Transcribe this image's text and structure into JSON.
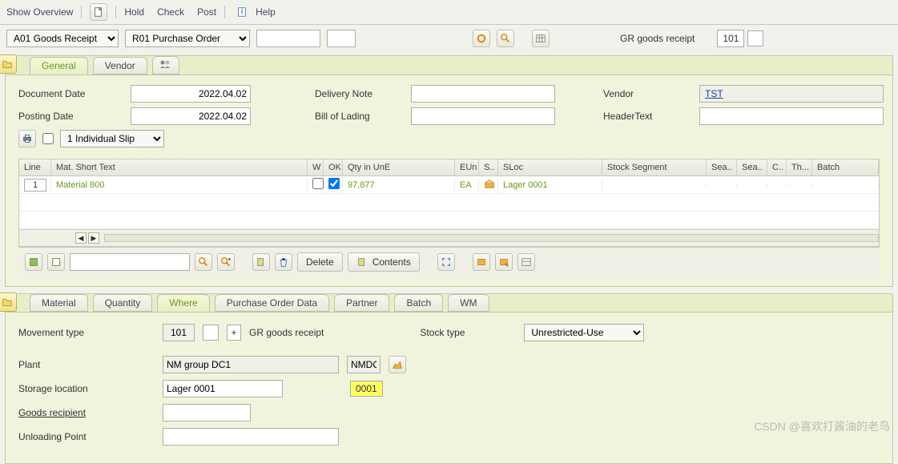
{
  "toolbar": {
    "show_overview": "Show Overview",
    "hold": "Hold",
    "check": "Check",
    "post": "Post",
    "help": "Help"
  },
  "row2": {
    "action": "A01 Goods Receipt",
    "ref": "R01 Purchase Order",
    "gr_label": "GR goods receipt",
    "gr_code": "101"
  },
  "header_tabs": {
    "general": "General",
    "vendor": "Vendor"
  },
  "header": {
    "doc_date_lbl": "Document Date",
    "doc_date": "2022.04.02",
    "post_date_lbl": "Posting Date",
    "post_date": "2022.04.02",
    "delivery_note_lbl": "Delivery Note",
    "delivery_note": "",
    "bill_lbl": "Bill of Lading",
    "bill": "",
    "vendor_lbl": "Vendor",
    "vendor": "TST",
    "header_text_lbl": "HeaderText",
    "header_text": "",
    "slip": "1 Individual Slip"
  },
  "table": {
    "cols": {
      "line": "Line",
      "mat": "Mat. Short Text",
      "w": "W",
      "ok": "OK",
      "qty": "Qty in UnE",
      "eun": "EUn",
      "s": "S..",
      "sloc": "SLoc",
      "seg": "Stock Segment",
      "sea1": "Sea..",
      "sea2": "Sea..",
      "c": "C..",
      "th": "Th...",
      "batch": "Batch"
    },
    "rows": [
      {
        "line": "1",
        "mat": "Material 800",
        "w": "",
        "ok": true,
        "qty": "97,877",
        "eun": "EA",
        "sloc": "Lager 0001"
      }
    ]
  },
  "toolbar2": {
    "delete": "Delete",
    "contents": "Contents"
  },
  "detail_tabs": {
    "material": "Material",
    "quantity": "Quantity",
    "where": "Where",
    "pod": "Purchase Order Data",
    "partner": "Partner",
    "batch": "Batch",
    "wm": "WM"
  },
  "detail": {
    "mvt_lbl": "Movement type",
    "mvt": "101",
    "mvt_desc": "GR goods receipt",
    "stock_lbl": "Stock type",
    "stock": "Unrestricted-Use",
    "plant_lbl": "Plant",
    "plant": "NM group DC1",
    "plant_code": "NMDC",
    "sloc_lbl": "Storage location",
    "sloc": "Lager 0001",
    "sloc_code": "0001",
    "recipient_lbl": "Goods recipient",
    "recipient": "",
    "unload_lbl": "Unloading Point",
    "unload": ""
  },
  "watermark": "CSDN @喜欢打酱油的老鸟"
}
